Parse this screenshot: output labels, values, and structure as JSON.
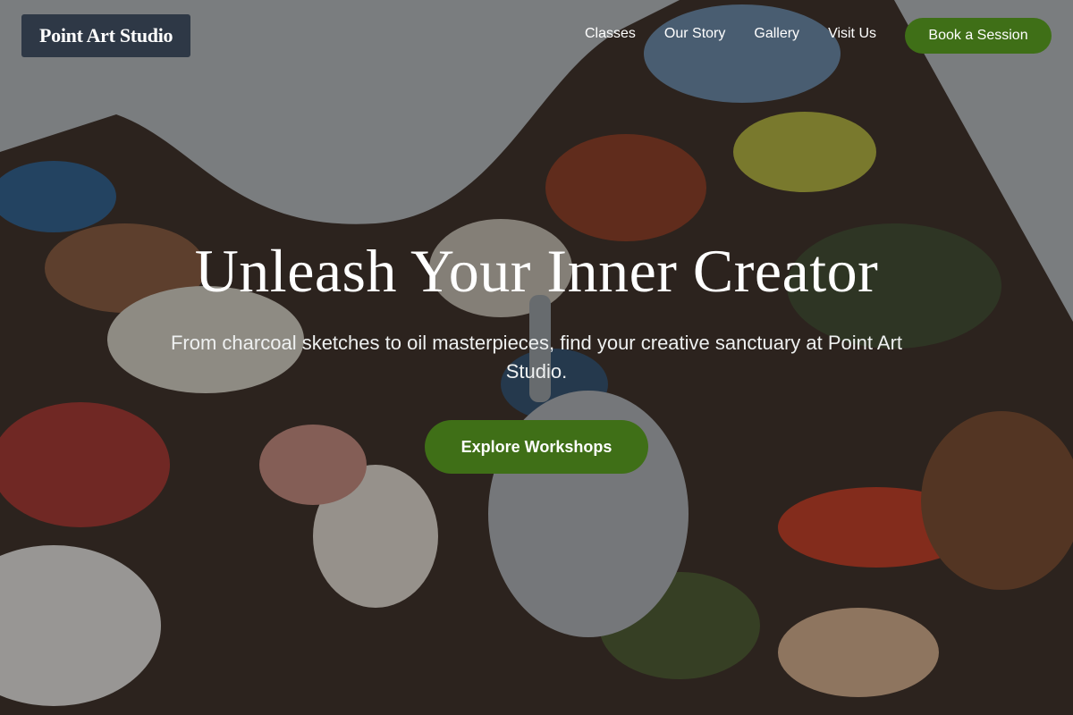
{
  "brand": {
    "name": "Point Art Studio"
  },
  "nav": {
    "links": [
      "Classes",
      "Our Story",
      "Gallery",
      "Visit Us"
    ],
    "cta_label": "Book a Session"
  },
  "hero": {
    "title": "Unleash Your Inner Creator",
    "subtitle": "From charcoal sketches to oil masterpieces, find your creative sanctuary at Point Art Studio.",
    "cta_label": "Explore Workshops"
  },
  "colors": {
    "accent": "#3f6f17",
    "logo_bg": "#2e3846",
    "text": "#ffffff"
  }
}
